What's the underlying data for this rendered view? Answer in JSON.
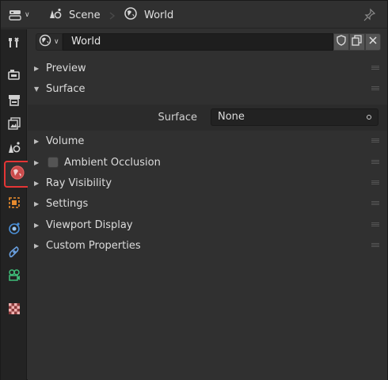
{
  "header": {
    "editor_type_icon": "properties-editor-icon",
    "breadcrumb": [
      {
        "label": "Scene",
        "icon": "scene-icon"
      },
      {
        "label": "World",
        "icon": "world-icon"
      }
    ],
    "pin_icon": "pin-icon"
  },
  "tabs": [
    {
      "name": "tool",
      "icon": "tool-icon"
    },
    {
      "name": "render",
      "icon": "render-icon"
    },
    {
      "name": "output",
      "icon": "output-icon"
    },
    {
      "name": "view-layer",
      "icon": "view-layer-icon"
    },
    {
      "name": "scene",
      "icon": "scene-icon"
    },
    {
      "name": "world",
      "icon": "world-icon",
      "active": true
    },
    {
      "name": "object",
      "icon": "object-icon"
    },
    {
      "name": "physics",
      "icon": "physics-icon"
    },
    {
      "name": "object-constraints",
      "icon": "constraint-icon"
    },
    {
      "name": "object-data",
      "icon": "camera-data-icon"
    },
    {
      "name": "texture",
      "icon": "texture-icon"
    }
  ],
  "datablock": {
    "name": "World",
    "buttons": [
      "fake-user-icon",
      "duplicate-icon",
      "unlink-icon"
    ]
  },
  "panels": {
    "preview": {
      "label": "Preview",
      "expanded": false
    },
    "surface": {
      "label": "Surface",
      "expanded": true,
      "field_label": "Surface",
      "field_value": "None"
    },
    "volume": {
      "label": "Volume",
      "expanded": false
    },
    "ambient_occlusion": {
      "label": "Ambient Occlusion",
      "expanded": false,
      "checked": false
    },
    "ray_visibility": {
      "label": "Ray Visibility",
      "expanded": false
    },
    "settings": {
      "label": "Settings",
      "expanded": false
    },
    "viewport_display": {
      "label": "Viewport Display",
      "expanded": false
    },
    "custom_properties": {
      "label": "Custom Properties",
      "expanded": false
    }
  },
  "colors": {
    "active_tab_outline": "#e53535",
    "background": "#303030",
    "tab_column": "#232323"
  }
}
